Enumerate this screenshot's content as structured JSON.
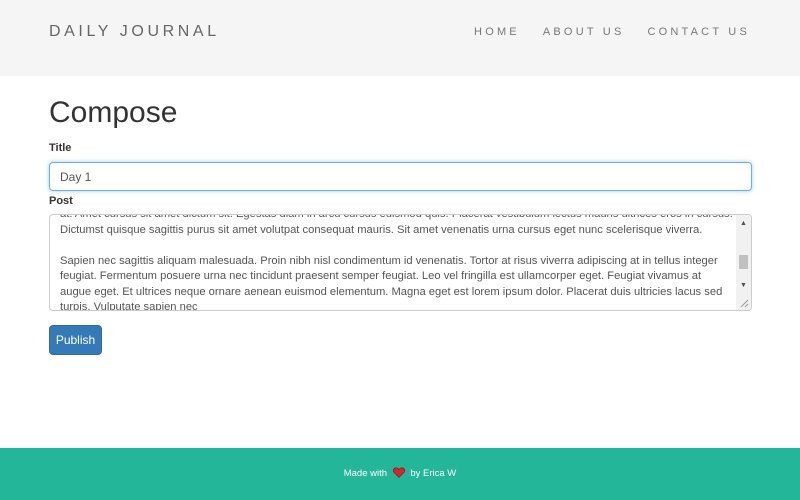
{
  "navbar": {
    "brand": "DAILY JOURNAL",
    "links": [
      "HOME",
      "ABOUT US",
      "CONTACT US"
    ]
  },
  "compose": {
    "heading": "Compose",
    "title_label": "Title",
    "title_value": "Day 1",
    "post_label": "Post",
    "post_paragraphs": [
      "at. Amet cursus sit amet dictum sit. Egestas diam in arcu cursus euismod quis. Placerat vestibulum lectus mauris ultrices eros in cursus. Dictumst quisque sagittis purus sit amet volutpat consequat mauris. Sit amet venenatis urna cursus eget nunc scelerisque viverra.",
      "Sapien nec sagittis aliquam malesuada. Proin nibh nisl condimentum id venenatis. Tortor at risus viverra adipiscing at in tellus integer feugiat. Fermentum posuere urna nec tincidunt praesent semper feugiat. Leo vel fringilla est ullamcorper eget. Feugiat vivamus at augue eget. Et ultrices neque ornare aenean euismod elementum. Magna eget est lorem ipsum dolor. Placerat duis ultricies lacus sed turpis. Vulputate sapien nec"
    ],
    "publish_label": "Publish"
  },
  "footer": {
    "before": "Made with",
    "heart_icon": "heart-icon",
    "after": "by Erica W"
  },
  "colors": {
    "navbar_bg": "#f5f5f5",
    "primary_button": "#337ab7",
    "footer_bg": "#24b699",
    "heart": "#d9232d"
  }
}
